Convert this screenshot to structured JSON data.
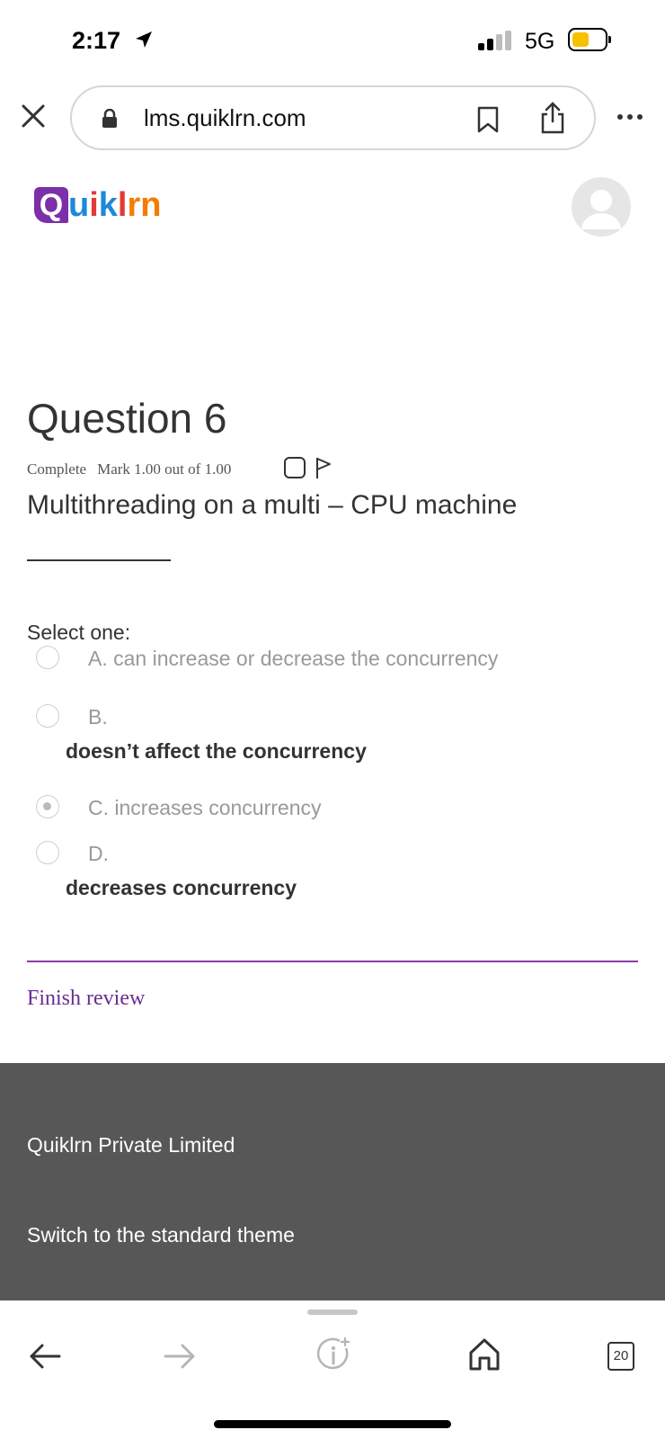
{
  "status_bar": {
    "time": "2:17",
    "network": "5G"
  },
  "browser": {
    "url": "lms.quiklrn.com",
    "tab_count": "20"
  },
  "site": {
    "logo": {
      "parts": [
        {
          "text": "Q",
          "color": "#7b2fa8"
        },
        {
          "text": "u",
          "color": "#1e88d9"
        },
        {
          "text": "i",
          "color": "#e53935"
        },
        {
          "text": "k",
          "color": "#1e88d9"
        },
        {
          "text": "l",
          "color": "#e53935"
        },
        {
          "text": "r",
          "color": "#f57c00"
        },
        {
          "text": "n",
          "color": "#f57c00"
        }
      ]
    }
  },
  "question": {
    "title": "Question 6",
    "status": "Complete",
    "mark": "Mark 1.00 out of 1.00",
    "text": "Multithreading on a multi – CPU machine",
    "select_label": "Select one:",
    "options": [
      {
        "label": "A. can increase or decrease the concurrency",
        "detail": "",
        "checked": false
      },
      {
        "label": "B.",
        "detail": "doesn’t affect the concurrency",
        "checked": false
      },
      {
        "label": "C. increases concurrency",
        "detail": "",
        "checked": true
      },
      {
        "label": "D.",
        "detail": "decreases concurrency",
        "checked": false
      }
    ]
  },
  "finish_review": "Finish review",
  "footer": {
    "company": "Quiklrn Private Limited",
    "theme_link": "Switch to the standard theme"
  },
  "colors": {
    "accent": "#8e3aa8",
    "link": "#6a2c91",
    "footer_bg": "#575757"
  }
}
